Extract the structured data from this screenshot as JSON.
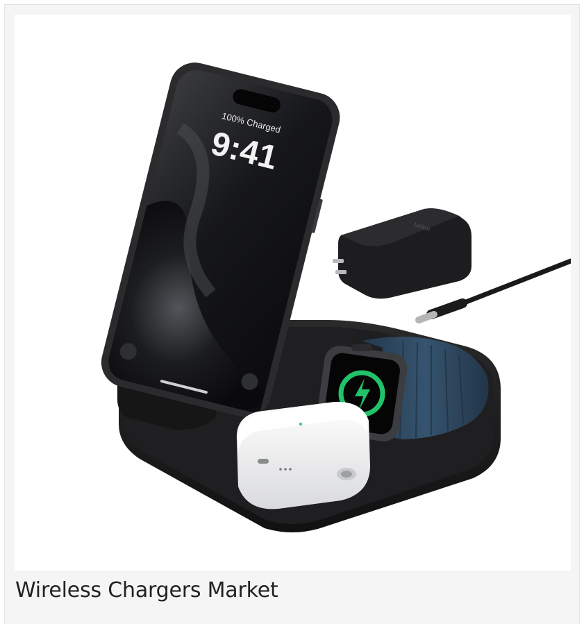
{
  "caption": {
    "text": "Wireless Chargers Market"
  },
  "image": {
    "subject": "3-in-1 wireless charging station with phone, watch, earbuds case and USB-C power adapter",
    "phone_screen": {
      "status": "100% Charged",
      "time": "9:41"
    },
    "adapter_brand": "belkin"
  },
  "colors": {
    "card_background": "#f5f5f5",
    "card_border": "#e2e2e2",
    "image_background": "#ffffff",
    "caption_text": "#222222",
    "charger_black": "#1b1b1c",
    "watch_charge_green": "#21c36a",
    "watch_band_blue": "#2e4860"
  }
}
